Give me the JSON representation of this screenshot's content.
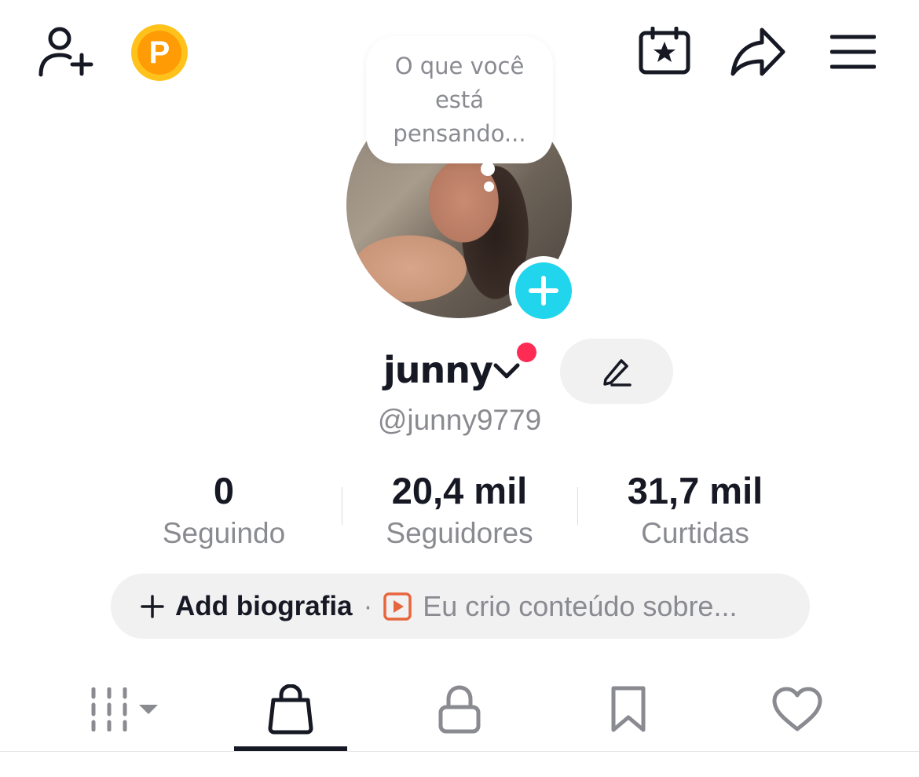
{
  "thought_bubble": {
    "text": "O que você está pensando..."
  },
  "profile": {
    "display_name": "junny",
    "handle": "@junny9779"
  },
  "stats": [
    {
      "value": "0",
      "label": "Seguindo"
    },
    {
      "value": "20,4 mil",
      "label": "Seguidores"
    },
    {
      "value": "31,7 mil",
      "label": "Curtidas"
    }
  ],
  "bio": {
    "add_label": "Add biografia",
    "separator": "·",
    "prompt": "Eu crio conteúdo sobre..."
  },
  "coin": {
    "letter": "P"
  },
  "tabs": [
    {
      "icon": "grid-icon",
      "active": false
    },
    {
      "icon": "shopping-bag-icon",
      "active": true
    },
    {
      "icon": "lock-icon",
      "active": false
    },
    {
      "icon": "bookmark-icon",
      "active": false
    },
    {
      "icon": "heart-icon",
      "active": false
    }
  ],
  "colors": {
    "accent_blue": "#20d5ec",
    "notification_red": "#fe2c55",
    "coin_yellow": "#ffc21a",
    "coin_orange": "#ff9b05",
    "text_primary": "#161823",
    "text_secondary": "#8a8b91",
    "pill_bg": "#f1f1f2",
    "video_icon_orange": "#e8663d"
  }
}
